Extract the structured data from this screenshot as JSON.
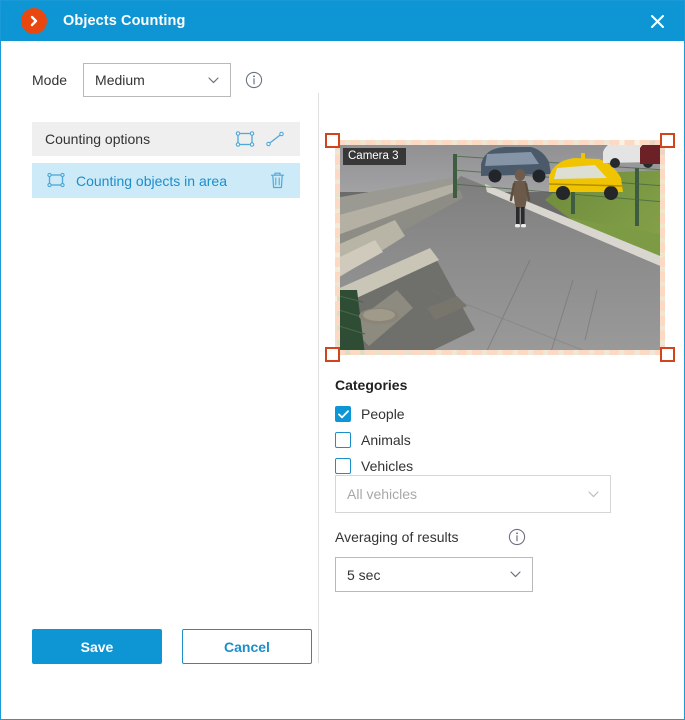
{
  "window": {
    "title": "Objects Counting",
    "logo_icon": "chevron-right-circle-icon",
    "close_icon": "close-icon"
  },
  "mode": {
    "label": "Mode",
    "value": "Medium",
    "options": [
      "Medium"
    ],
    "caret_icon": "chevron-down-icon",
    "info_icon": "info-icon"
  },
  "counting_options": {
    "header_label": "Counting options",
    "add_area_icon": "draw-area-icon",
    "add_line_icon": "draw-line-icon",
    "items": [
      {
        "label": "Counting objects in area",
        "icon": "area-icon",
        "delete_icon": "trash-icon"
      }
    ]
  },
  "preview": {
    "camera_label": "Camera 3",
    "selection_color": "#e8401a",
    "handle_icon": "resize-handle"
  },
  "categories": {
    "title": "Categories",
    "items": [
      {
        "label": "People",
        "checked": true
      },
      {
        "label": "Animals",
        "checked": false
      },
      {
        "label": "Vehicles",
        "checked": false
      }
    ],
    "vehicle_filter": {
      "value": "All vehicles",
      "options": [
        "All vehicles"
      ],
      "caret_icon": "chevron-down-icon",
      "disabled": true
    }
  },
  "averaging": {
    "label": "Averaging of results",
    "info_icon": "info-icon",
    "value": "5 sec",
    "options": [
      "5 sec"
    ],
    "caret_icon": "chevron-down-icon"
  },
  "footer": {
    "save_label": "Save",
    "cancel_label": "Cancel"
  },
  "colors": {
    "accent": "#0e96d4",
    "logo": "#e8470f",
    "selection": "#e8401a",
    "row_selected": "#cceaf7",
    "link": "#1c8fc9"
  }
}
